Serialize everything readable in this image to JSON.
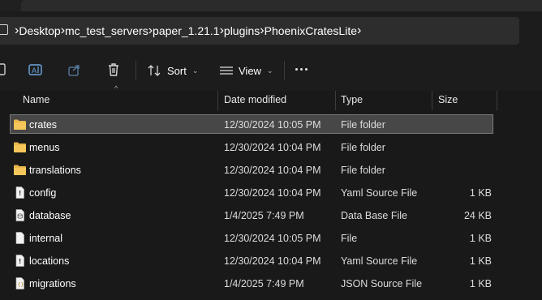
{
  "breadcrumbs": [
    "Desktop",
    "mc_test_servers",
    "paper_1.21.1",
    "plugins",
    "PhoenixCratesLite"
  ],
  "toolbar": {
    "sort_label": "Sort",
    "view_label": "View"
  },
  "columns": {
    "name": "Name",
    "date": "Date modified",
    "type": "Type",
    "size": "Size"
  },
  "files": [
    {
      "name": "crates",
      "date": "12/30/2024 10:05 PM",
      "type": "File folder",
      "size": "",
      "icon": "folder-icon"
    },
    {
      "name": "menus",
      "date": "12/30/2024 10:04 PM",
      "type": "File folder",
      "size": "",
      "icon": "folder-icon"
    },
    {
      "name": "translations",
      "date": "12/30/2024 10:04 PM",
      "type": "File folder",
      "size": "",
      "icon": "folder-icon"
    },
    {
      "name": "config",
      "date": "12/30/2024 10:04 PM",
      "type": "Yaml Source File",
      "size": "1 KB",
      "icon": "yaml-file-icon"
    },
    {
      "name": "database",
      "date": "1/4/2025 7:49 PM",
      "type": "Data Base File",
      "size": "24 KB",
      "icon": "database-file-icon"
    },
    {
      "name": "internal",
      "date": "12/30/2024 10:05 PM",
      "type": "File",
      "size": "1 KB",
      "icon": "file-icon"
    },
    {
      "name": "locations",
      "date": "12/30/2024 10:04 PM",
      "type": "Yaml Source File",
      "size": "1 KB",
      "icon": "yaml-file-icon"
    },
    {
      "name": "migrations",
      "date": "1/4/2025 7:49 PM",
      "type": "JSON Source File",
      "size": "1 KB",
      "icon": "json-file-icon"
    }
  ],
  "selected_index": 0,
  "colors": {
    "folder": "#e8b64a",
    "selection": "#474747",
    "background": "#191919"
  }
}
